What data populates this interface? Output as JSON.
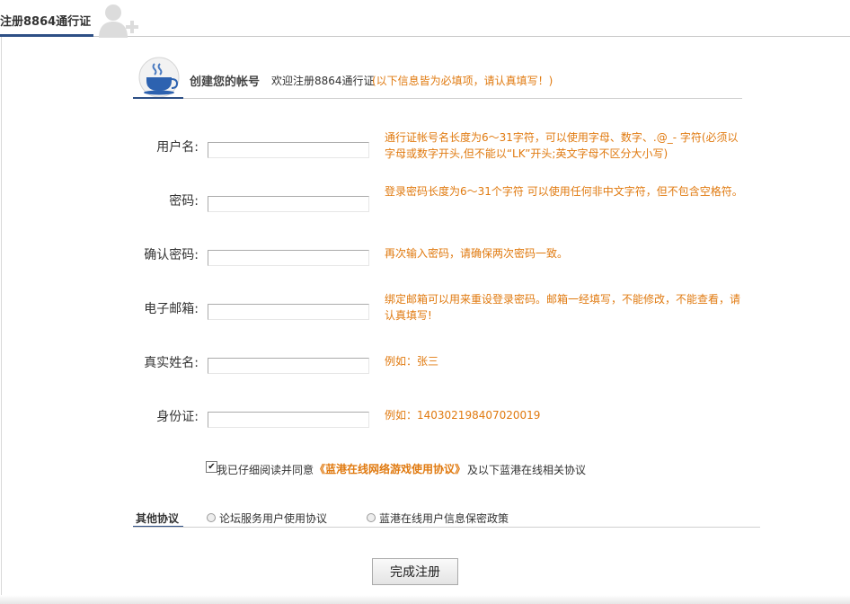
{
  "tab": {
    "title": "注册8864通行证"
  },
  "header": {
    "title": "创建您的帐号",
    "welcome": "欢迎注册8864通行证",
    "note": "(以下信息皆为必填项，请认真填写！)"
  },
  "form": {
    "fields": [
      {
        "label": "用户名:",
        "value": "",
        "hint": "通行证帐号名长度为6～31字符，可以使用字母、数字、.@_- 字符(必须以字母或数字开头,但不能以“LK”开头;英文字母不区分大小写)"
      },
      {
        "label": "密码:",
        "value": "",
        "hint": "登录密码长度为6～31个字符 可以使用任何非中文字符，但不包含空格符。"
      },
      {
        "label": "确认密码:",
        "value": "",
        "hint": "再次输入密码，请确保两次密码一致。"
      },
      {
        "label": "电子邮箱:",
        "value": "",
        "hint": "绑定邮箱可以用来重设登录密码。邮箱一经填写，不能修改，不能查看，请认真填写!"
      },
      {
        "label": "真实姓名:",
        "value": "",
        "hint": "例如：张三"
      },
      {
        "label": "身份证:",
        "value": "",
        "hint": "例如：140302198407020019"
      }
    ]
  },
  "agreement": {
    "checked": true,
    "prefix": "我已仔细阅读并同意",
    "link": "《蓝港在线网络游戏使用协议》",
    "suffix": "及以下蓝港在线相关协议"
  },
  "other": {
    "title": "其他协议",
    "links": [
      "论坛服务用户使用协议",
      "蓝港在线用户信息保密政策"
    ]
  },
  "submit": {
    "label": "完成注册"
  },
  "colors": {
    "accent": "#e07a10",
    "tab_underline": "#2d4f85"
  }
}
